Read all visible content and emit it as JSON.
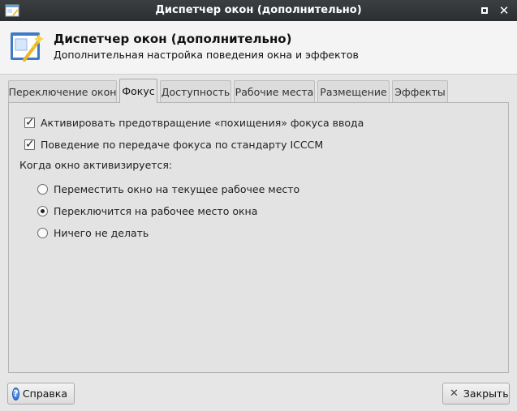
{
  "window": {
    "title": "Диспетчер окон (дополнительно)"
  },
  "header": {
    "title": "Диспетчер окон (дополнительно)",
    "subtitle": "Дополнительная настройка поведения окна и эффектов"
  },
  "tabs": [
    {
      "label": "Переключение окон",
      "active": false
    },
    {
      "label": "Фокус",
      "active": true
    },
    {
      "label": "Доступность",
      "active": false
    },
    {
      "label": "Рабочие места",
      "active": false
    },
    {
      "label": "Размещение",
      "active": false
    },
    {
      "label": "Эффекты",
      "active": false
    }
  ],
  "focus": {
    "prevent_steal": {
      "label": "Активировать предотвращение «похищения» фокуса ввода",
      "checked": true
    },
    "icccm": {
      "label": "Поведение по передаче фокуса по стандарту ICCCM",
      "checked": true
    },
    "activate_heading": "Когда окно активизируется:",
    "options": [
      {
        "label": "Переместить окно на текущее рабочее место",
        "selected": false
      },
      {
        "label": "Переключится на рабочее место окна",
        "selected": true
      },
      {
        "label": "Ничего не делать",
        "selected": false
      }
    ]
  },
  "buttons": {
    "help": "Справка",
    "close": "Закрыть"
  },
  "icons": {
    "app": "window-settings-icon",
    "help": "help-icon",
    "close": "close-icon"
  }
}
